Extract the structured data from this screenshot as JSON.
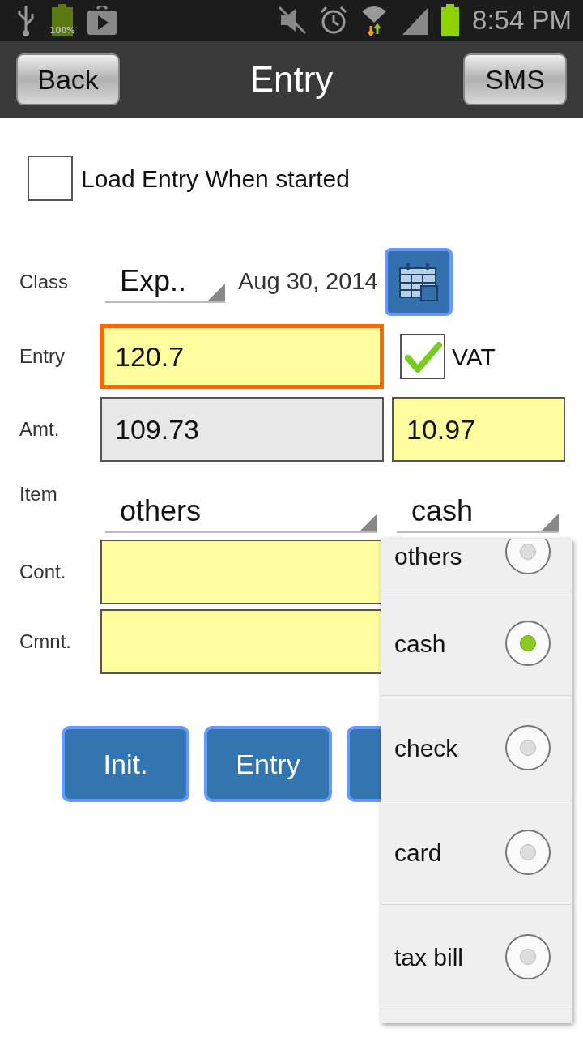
{
  "status_bar": {
    "battery_label": "100%",
    "time": "8:54 PM"
  },
  "header": {
    "back": "Back",
    "title": "Entry",
    "sms": "SMS"
  },
  "load_on_start": {
    "label": "Load Entry When started",
    "checked": false
  },
  "class_row": {
    "label": "Class",
    "value": "Exp..",
    "date": "Aug 30, 2014"
  },
  "entry_row": {
    "label": "Entry",
    "value": "120.7",
    "focused": true,
    "vat_label": "VAT",
    "vat_checked": true
  },
  "amount_row": {
    "label": "Amt.",
    "net": "109.73",
    "vat": "10.97"
  },
  "item_row": {
    "label": "Item",
    "item": "others",
    "payment": "cash"
  },
  "contact_row": {
    "label": "Cont."
  },
  "comment_row": {
    "label": "Cmnt."
  },
  "buttons": [
    {
      "kind": "labeled",
      "label": "Init."
    },
    {
      "kind": "labeled",
      "label": "Entry"
    },
    {
      "kind": "covered"
    }
  ],
  "payment_menu": [
    {
      "label": "others",
      "selected": false
    },
    {
      "label": "cash",
      "selected": true
    },
    {
      "label": "check",
      "selected": false
    },
    {
      "label": "card",
      "selected": false
    },
    {
      "label": "tax bill",
      "selected": false
    }
  ]
}
